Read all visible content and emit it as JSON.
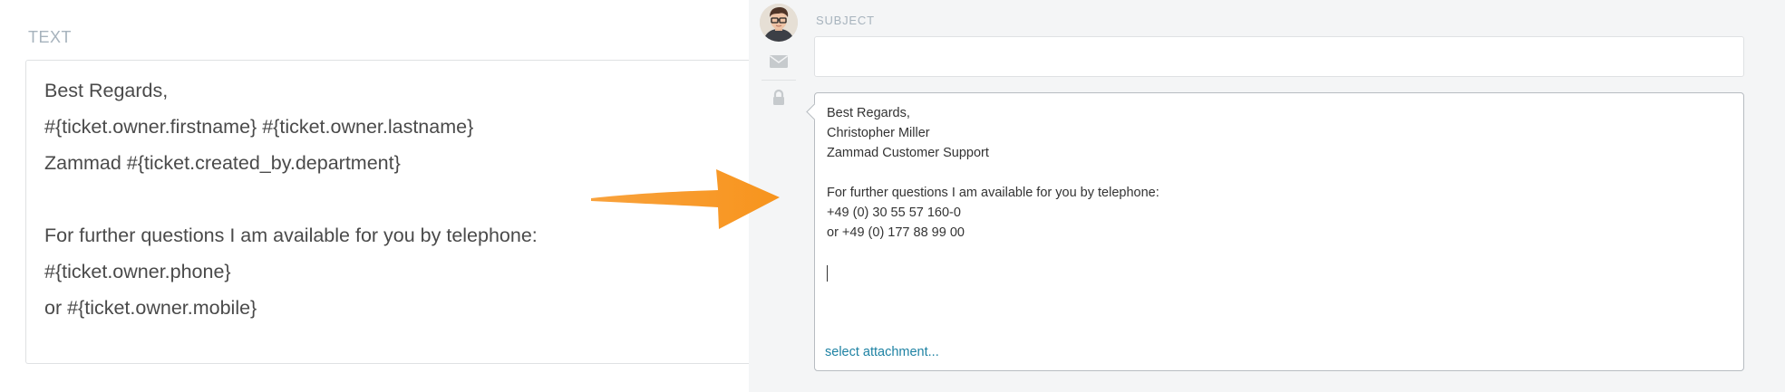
{
  "left": {
    "label": "TEXT",
    "lines": [
      "Best Regards,",
      "#{ticket.owner.firstname} #{ticket.owner.lastname}",
      "Zammad #{ticket.created_by.department}",
      "",
      "For further questions I am available for you by telephone:",
      "#{ticket.owner.phone}",
      "or #{ticket.owner.mobile}"
    ]
  },
  "composer": {
    "subject_label": "SUBJECT",
    "subject_value": "",
    "body_lines": [
      "Best Regards,",
      "Christopher Miller",
      "Zammad Customer Support",
      "",
      "For further questions I am available for you by telephone:",
      "+49 (0) 30 55 57 160-0",
      "or +49 (0) 177 88 99 00"
    ],
    "attachment_link": "select attachment..."
  },
  "icons": {
    "avatar": "avatar",
    "article_type": "envelope-icon",
    "visibility": "lock-icon",
    "arrow": "orange-arrow"
  },
  "colors": {
    "arrow": "#f7941d",
    "link": "#1e82a3",
    "label": "#a7b3bd",
    "panel_bg": "#f4f5f6"
  }
}
